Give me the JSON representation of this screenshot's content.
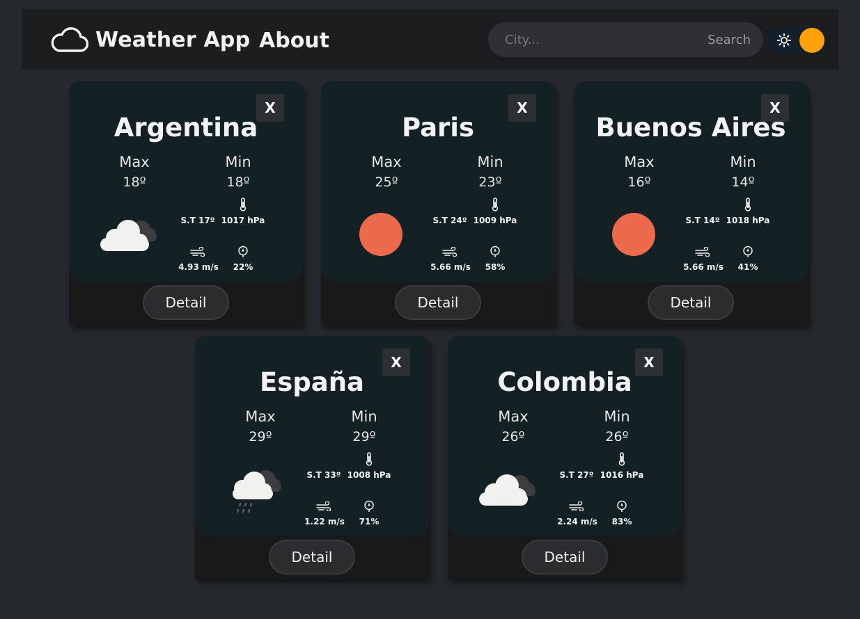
{
  "nav": {
    "title": "Weather App",
    "about": "About",
    "search_placeholder": "City...",
    "search_button": "Search"
  },
  "colors": {
    "background": "#25282c",
    "navbar": "#1c1d1f",
    "card_top": "#132024",
    "card_bottom": "#19191a",
    "toggle_knob": "#ffa20a",
    "sun_disc": "#ec6a4c"
  },
  "cards": [
    {
      "city": "Argentina",
      "close": "X",
      "max_label": "Max",
      "min_label": "Min",
      "max": "18º",
      "min": "18º",
      "feels_like": "S.T 17º",
      "pressure": "1017 hPa",
      "wind": "4.93 m/s",
      "humidity": "22%",
      "detail": "Detail",
      "icon": "broken-clouds-icon"
    },
    {
      "city": "Paris",
      "close": "X",
      "max_label": "Max",
      "min_label": "Min",
      "max": "25º",
      "min": "23º",
      "feels_like": "S.T 24º",
      "pressure": "1009 hPa",
      "wind": "5.66 m/s",
      "humidity": "58%",
      "detail": "Detail",
      "icon": "sun-icon"
    },
    {
      "city": "Buenos Aires",
      "close": "X",
      "max_label": "Max",
      "min_label": "Min",
      "max": "16º",
      "min": "14º",
      "feels_like": "S.T 14º",
      "pressure": "1018 hPa",
      "wind": "5.66 m/s",
      "humidity": "41%",
      "detail": "Detail",
      "icon": "sun-icon"
    },
    {
      "city": "España",
      "close": "X",
      "max_label": "Max",
      "min_label": "Min",
      "max": "29º",
      "min": "29º",
      "feels_like": "S.T 33º",
      "pressure": "1008 hPa",
      "wind": "1.22 m/s",
      "humidity": "71%",
      "detail": "Detail",
      "icon": "rain-cloud-icon"
    },
    {
      "city": "Colombia",
      "close": "X",
      "max_label": "Max",
      "min_label": "Min",
      "max": "26º",
      "min": "26º",
      "feels_like": "S.T 27º",
      "pressure": "1016 hPa",
      "wind": "2.24 m/s",
      "humidity": "83%",
      "detail": "Detail",
      "icon": "broken-clouds-icon"
    }
  ]
}
